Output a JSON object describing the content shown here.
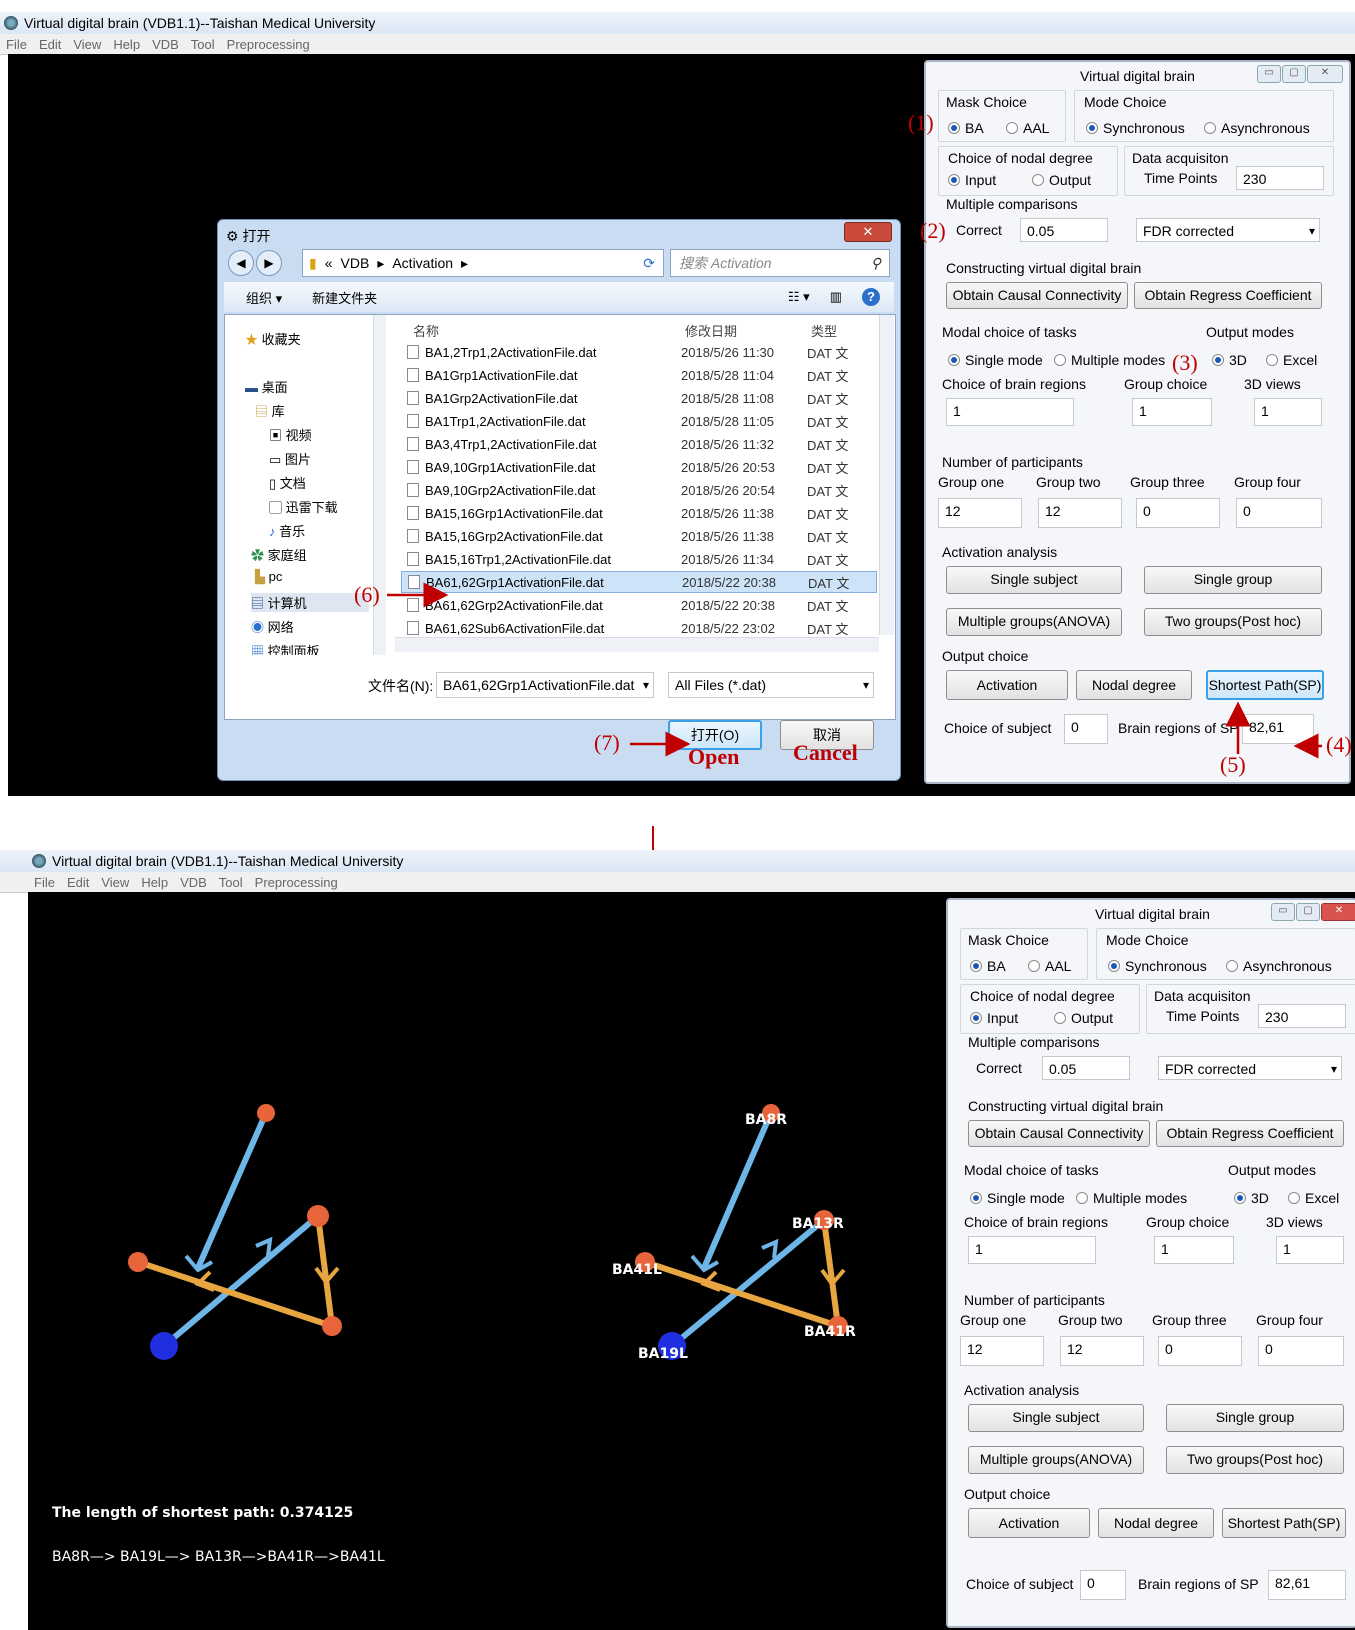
{
  "app": {
    "title": "Virtual digital brain (VDB1.1)--Taishan Medical University",
    "menu": [
      "File",
      "Edit",
      "View",
      "Help",
      "VDB",
      "Tool",
      "Preprocessing"
    ]
  },
  "panel": {
    "title": "Virtual   digital   brain",
    "mask_choice": "Mask Choice",
    "mask_opts": [
      "BA",
      "AAL"
    ],
    "mode_choice": "Mode Choice",
    "mode_opts": [
      "Synchronous",
      "Asynchronous"
    ],
    "nodal_title": "Choice of nodal degree",
    "nodal_opts": [
      "Input",
      "Output"
    ],
    "data_acq": "Data acquisiton",
    "time_points_label": "Time Points",
    "time_points": "230",
    "multiple_comparisons": "Multiple comparisons",
    "correct_label": "Correct",
    "correct_value": "0.05",
    "correction_method": "FDR corrected",
    "constructing": "Constructing virtual digital brain",
    "btn_causal": "Obtain  Causal Connectivity",
    "btn_regress": "Obtain Regress Coefficient",
    "modal_choice": "Modal choice of tasks",
    "modal_opts": [
      "Single mode",
      "Multiple modes"
    ],
    "output_modes": "Output modes",
    "output_opts": [
      "3D",
      "Excel"
    ],
    "brain_regions_label": "Choice of brain regions",
    "brain_regions": "1",
    "group_choice_label": "Group choice",
    "group_choice": "1",
    "views_label": "3D views",
    "views": "1",
    "participants": "Number of participants",
    "group_labels": [
      "Group one",
      "Group two",
      "Group three",
      "Group four"
    ],
    "group_values": [
      "12",
      "12",
      "0",
      "0"
    ],
    "activation_analysis": "Activation analysis",
    "btn_single_subject": "Single subject",
    "btn_single_group": "Single group",
    "btn_anova": "Multiple groups(ANOVA)",
    "btn_posthoc": "Two groups(Post hoc)",
    "output_choice": "Output choice",
    "btn_activation": "Activation",
    "btn_nodal": "Nodal degree",
    "btn_sp": "Shortest Path(SP)",
    "subject_label": "Choice of subject",
    "subject_value": "0",
    "sp_label": "Brain regions of SP",
    "sp_value": "82,61"
  },
  "dialog": {
    "title": "打开",
    "close": "✕",
    "breadcrumb": [
      "«",
      "VDB",
      "Activation"
    ],
    "search_placeholder": "搜索 Activation",
    "organize": "组织 ▾",
    "new_folder": "新建文件夹",
    "nav": [
      "收藏夹",
      "桌面",
      "库",
      "视频",
      "图片",
      "文档",
      "迅雷下载",
      "音乐",
      "家庭组",
      "pc",
      "计算机",
      "网络",
      "控制面板"
    ],
    "col_name": "名称",
    "col_date": "修改日期",
    "col_type": "类型",
    "files": [
      {
        "name": "BA1,2Trp1,2ActivationFile.dat",
        "date": "2018/5/26 11:30",
        "type": "DAT 文"
      },
      {
        "name": "BA1Grp1ActivationFile.dat",
        "date": "2018/5/28 11:04",
        "type": "DAT 文"
      },
      {
        "name": "BA1Grp2ActivationFile.dat",
        "date": "2018/5/28 11:08",
        "type": "DAT 文"
      },
      {
        "name": "BA1Trp1,2ActivationFile.dat",
        "date": "2018/5/28 11:05",
        "type": "DAT 文"
      },
      {
        "name": "BA3,4Trp1,2ActivationFile.dat",
        "date": "2018/5/26 11:32",
        "type": "DAT 文"
      },
      {
        "name": "BA9,10Grp1ActivationFile.dat",
        "date": "2018/5/26 20:53",
        "type": "DAT 文"
      },
      {
        "name": "BA9,10Grp2ActivationFile.dat",
        "date": "2018/5/26 20:54",
        "type": "DAT 文"
      },
      {
        "name": "BA15,16Grp1ActivationFile.dat",
        "date": "2018/5/26 11:38",
        "type": "DAT 文"
      },
      {
        "name": "BA15,16Grp2ActivationFile.dat",
        "date": "2018/5/26 11:38",
        "type": "DAT 文"
      },
      {
        "name": "BA15,16Trp1,2ActivationFile.dat",
        "date": "2018/5/26 11:34",
        "type": "DAT 文"
      },
      {
        "name": "BA61,62Grp1ActivationFile.dat",
        "date": "2018/5/22 20:38",
        "type": "DAT 文"
      },
      {
        "name": "BA61,62Grp2ActivationFile.dat",
        "date": "2018/5/22 20:38",
        "type": "DAT 文"
      },
      {
        "name": "BA61,62Sub6ActivationFile.dat",
        "date": "2018/5/22 23:02",
        "type": "DAT 文"
      }
    ],
    "filename_label": "文件名(N):",
    "filename_value": "BA61,62Grp1ActivationFile.dat",
    "filter": "All Files (*.dat)",
    "btn_open": "打开(O)",
    "btn_cancel": "取消"
  },
  "annotations": {
    "n1": "(1)",
    "n2": "(2)",
    "n3": "(3)",
    "n4": "(4)",
    "n5": "(5)",
    "n6": "(6)",
    "n7": "(7)",
    "open": "Open",
    "cancel": "Cancel"
  },
  "result": {
    "length_text": "The length of shortest path:  0.374125",
    "path_text": "BA8R—> BA19L—> BA13R—>BA41R—>BA41L",
    "node_labels": [
      "BA8R",
      "BA13R",
      "BA41L",
      "BA41R",
      "BA19L"
    ]
  },
  "colors": {
    "edge_blue": "#6fb6e8",
    "edge_orange": "#e8a640",
    "node_orange": "#e8643a",
    "node_blue": "#1f2fe0",
    "annotation_red": "#c00000"
  }
}
